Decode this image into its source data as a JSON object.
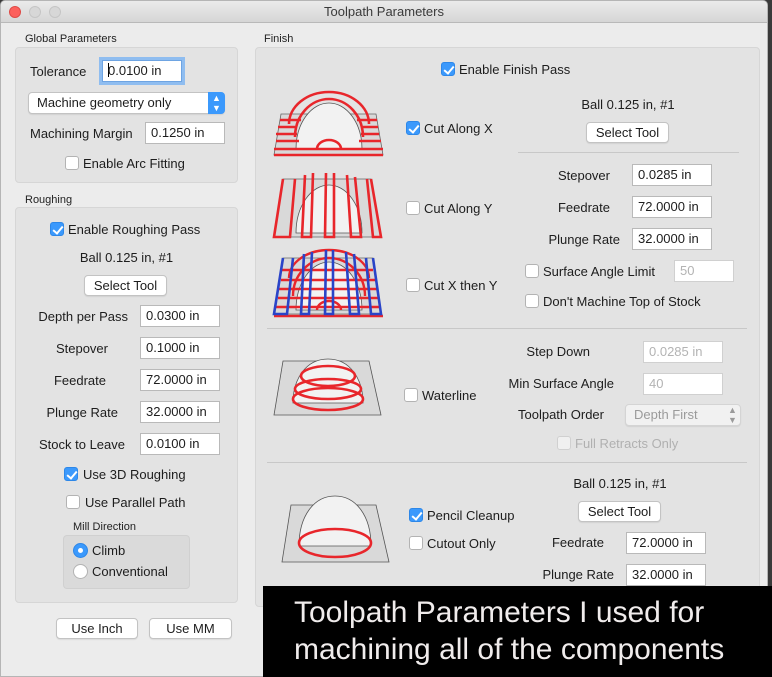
{
  "window": {
    "title": "Toolpath Parameters"
  },
  "global": {
    "label": "Global Parameters",
    "tolerance_label": "Tolerance",
    "tolerance_value": "0.0100 in",
    "geometry_select": "Machine geometry only",
    "margin_label": "Machining Margin",
    "margin_value": "0.1250 in",
    "arc_fitting_label": "Enable Arc Fitting",
    "arc_fitting_checked": false
  },
  "roughing": {
    "label": "Roughing",
    "enable_label": "Enable Roughing Pass",
    "enable_checked": true,
    "tool_name": "Ball 0.125 in, #1",
    "select_tool": "Select Tool",
    "depth_label": "Depth per Pass",
    "depth_value": "0.0300 in",
    "stepover_label": "Stepover",
    "stepover_value": "0.1000 in",
    "feedrate_label": "Feedrate",
    "feedrate_value": "72.0000 in",
    "plunge_label": "Plunge Rate",
    "plunge_value": "32.0000 in",
    "stock_label": "Stock to Leave",
    "stock_value": "0.0100 in",
    "use3d_label": "Use 3D Roughing",
    "use3d_checked": true,
    "parallel_label": "Use Parallel Path",
    "parallel_checked": false,
    "mill_direction_label": "Mill Direction",
    "climb_label": "Climb",
    "conventional_label": "Conventional",
    "mill_direction_selected": "Climb"
  },
  "units": {
    "inch_label": "Use Inch",
    "mm_label": "Use MM"
  },
  "finish": {
    "label": "Finish",
    "enable_label": "Enable Finish Pass",
    "enable_checked": true,
    "cut_x_label": "Cut Along X",
    "cut_x_checked": true,
    "cut_y_label": "Cut Along Y",
    "cut_y_checked": false,
    "cut_xy_label": "Cut X then Y",
    "cut_xy_checked": false,
    "tool_name": "Ball 0.125 in, #1",
    "select_tool": "Select Tool",
    "stepover_label": "Stepover",
    "stepover_value": "0.0285 in",
    "feedrate_label": "Feedrate",
    "feedrate_value": "72.0000 in",
    "plunge_label": "Plunge Rate",
    "plunge_value": "32.0000 in",
    "surface_angle_label": "Surface Angle Limit",
    "surface_angle_checked": false,
    "surface_angle_value": "50",
    "dont_machine_top_label": "Don't Machine Top of Stock",
    "dont_machine_top_checked": false
  },
  "waterline": {
    "label": "Waterline",
    "checked": false,
    "step_down_label": "Step Down",
    "step_down_value": "0.0285 in",
    "min_angle_label": "Min Surface Angle",
    "min_angle_value": "40",
    "order_label": "Toolpath Order",
    "order_value": "Depth First",
    "full_retracts_label": "Full Retracts Only",
    "full_retracts_checked": false
  },
  "pencil": {
    "label": "Pencil Cleanup",
    "checked": true,
    "cutout_label": "Cutout Only",
    "cutout_checked": false,
    "tool_name": "Ball 0.125 in, #1",
    "select_tool": "Select Tool",
    "feedrate_label": "Feedrate",
    "feedrate_value": "72.0000 in",
    "plunge_label": "Plunge Rate",
    "plunge_value": "32.0000 in"
  },
  "caption": {
    "line1": "Toolpath Parameters I used for",
    "line2": "machining all of the components"
  },
  "colors": {
    "accent": "#3b99fc",
    "toolpath_x": "#e8262b",
    "toolpath_y": "#2a44c8"
  }
}
